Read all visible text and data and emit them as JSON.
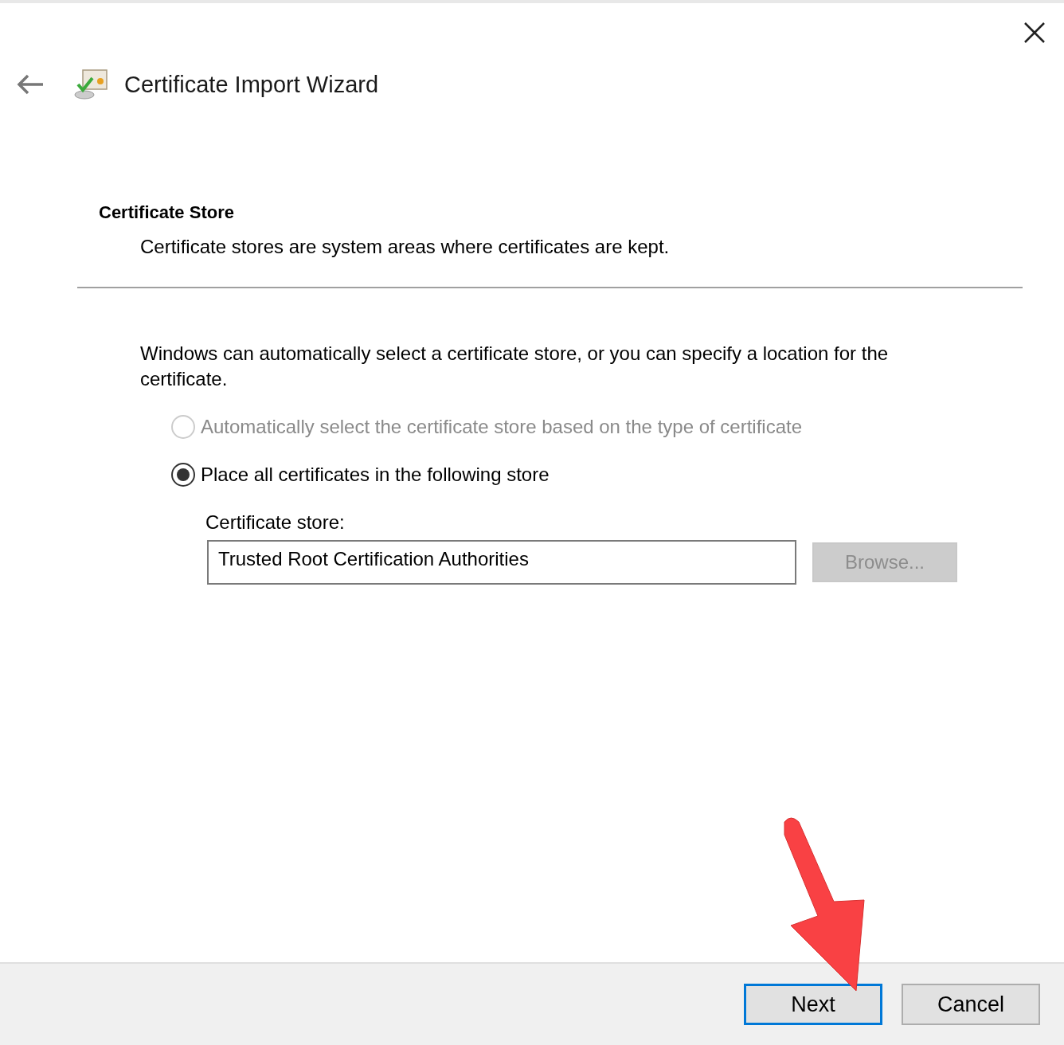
{
  "window": {
    "title": "Certificate Import Wizard"
  },
  "page": {
    "heading": "Certificate Store",
    "subtitle": "Certificate stores are system areas where certificates are kept."
  },
  "intro": "Windows can automatically select a certificate store, or you can specify a location for the certificate.",
  "options": [
    {
      "label": "Automatically select the certificate store based on the type of certificate",
      "selected": false,
      "disabled": true
    },
    {
      "label": "Place all certificates in the following store",
      "selected": true,
      "disabled": false
    }
  ],
  "store": {
    "label": "Certificate store:",
    "value": "Trusted Root Certification Authorities",
    "browse": {
      "label": "Browse...",
      "disabled": true
    }
  },
  "buttons": [
    {
      "label": "Next",
      "focused": true
    },
    {
      "label": "Cancel",
      "focused": false
    }
  ]
}
